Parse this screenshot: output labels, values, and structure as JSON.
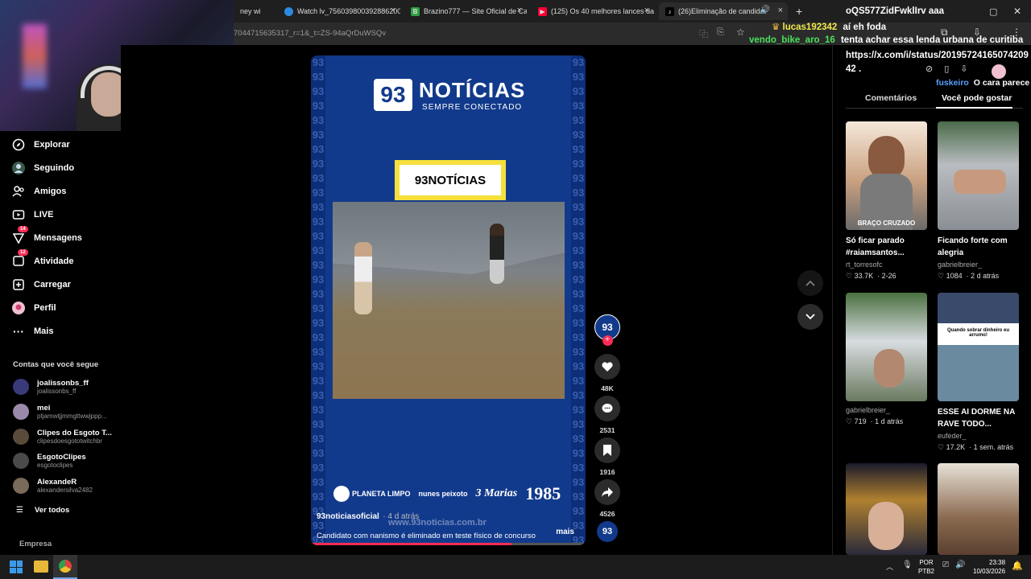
{
  "browser": {
    "tabs": [
      {
        "label": "ney wi",
        "icon": "generic-tab-icon",
        "color": "#444"
      },
      {
        "label": "Watch lv_756039800392886200",
        "icon": "watch-icon",
        "color": "#2b8ae0"
      },
      {
        "label": "Brazino777 — Site Oficial de Ca",
        "icon": "brazino-icon",
        "color": "#2ea043"
      },
      {
        "label": "(125) Os 40 melhores lances da",
        "icon": "youtube-icon",
        "color": "#ff0033"
      },
      {
        "label": "(26)Eliminação de candidat",
        "icon": "tiktok-icon",
        "color": "#000"
      }
    ],
    "url": "7044715635317_r=1&_t=ZS-94aQrDuWSQv"
  },
  "leftnav": {
    "items": [
      {
        "label": "Explorar",
        "icon": "compass-icon"
      },
      {
        "label": "Seguindo",
        "icon": "following-icon"
      },
      {
        "label": "Amigos",
        "icon": "friends-icon"
      },
      {
        "label": "LIVE",
        "icon": "live-icon"
      },
      {
        "label": "Mensagens",
        "icon": "messages-icon",
        "badge": "14"
      },
      {
        "label": "Atividade",
        "icon": "activity-icon",
        "badge": "12"
      },
      {
        "label": "Carregar",
        "icon": "upload-icon"
      },
      {
        "label": "Perfil",
        "icon": "profile-icon"
      },
      {
        "label": "Mais",
        "icon": "more-icon"
      }
    ],
    "following_header": "Contas que você segue",
    "following": [
      {
        "name": "joalissonbs_ff",
        "handle": "joalissonbs_ff"
      },
      {
        "name": "mei",
        "handle": "ptjamwtjjmmgttwwjppp..."
      },
      {
        "name": "Clipes do Esgoto T...",
        "handle": "clipesdoesgototwitchbr"
      },
      {
        "name": "EsgotoClipes",
        "handle": "esgotoclipes"
      },
      {
        "name": "AlexandeR",
        "handle": "alexandersilva2482"
      }
    ],
    "see_all": "Ver todos",
    "footer": "Empresa"
  },
  "video": {
    "brand_name": "NOTÍCIAS",
    "brand_num": "93",
    "brand_tagline": "SEMPRE CONECTADO",
    "tag": "93NOTÍCIAS",
    "sponsors": [
      "PLANETA LIMPO",
      "nunes peixoto",
      "3 Marias",
      "1985"
    ],
    "author": "93noticiasoficial",
    "ago": "· 4 d atrás",
    "description": "Candidato com nanismo é eliminado em teste físico de concurso",
    "more": "mais",
    "watermark": "www.93noticias.com.br",
    "progress_pct": 73
  },
  "actions": {
    "likes": "48K",
    "comments": "2531",
    "saves": "1916",
    "shares": "4526"
  },
  "chat": [
    {
      "user": "",
      "text": "oQS577ZidFwklIrv aaa",
      "color": "#ffffff"
    },
    {
      "user": "lucas192342",
      "text": "aí eh foda",
      "color": "#f3e84a"
    },
    {
      "user": "vendo_bike_aro_16",
      "text": "tenta achar essa lenda urbana de curitiba",
      "color": "#4ae05a"
    },
    {
      "user": "",
      "text": "https://x.com/i/status/2019572416507420942 .",
      "color": "#ffffff"
    },
    {
      "user": "fuskeiro",
      "text": "O cara parece",
      "color": "#5aa0ff"
    }
  ],
  "rightpanel": {
    "tabs": [
      "Comentários",
      "Você pode gostar"
    ],
    "cards": [
      {
        "title": "Só ficar parado #raiamsantos...",
        "user": "rt_torresofc",
        "likes": "33.7K",
        "time": "2-26",
        "overlay": "BRAÇO CRUZADO"
      },
      {
        "title": "Ficando forte com alegria",
        "user": "gabrielbreier_",
        "likes": "1084",
        "time": "2 d atrás",
        "overlay": ""
      },
      {
        "title": "",
        "user": "gabrielbreier_",
        "likes": "719",
        "time": "1 d atrás",
        "overlay": ""
      },
      {
        "title": "ESSE AI DORME NA RAVE TODO...",
        "user": "eufeder_",
        "likes": "17.2K",
        "time": "1 sem. atrás",
        "overlay": "Quando sobrar dinheiro eu arrumo!"
      },
      {
        "title": "",
        "user": "",
        "likes": "",
        "time": "",
        "overlay": ""
      },
      {
        "title": "",
        "user": "",
        "likes": "",
        "time": "",
        "overlay": ""
      }
    ]
  },
  "taskbar": {
    "lang": "POR",
    "layout": "PTB2",
    "time": "23:38",
    "date": "10/03/2026"
  },
  "colors": {
    "accent": "#fe2c55",
    "video_bg": "#123a8c",
    "tag_yellow": "#f5e03c"
  }
}
